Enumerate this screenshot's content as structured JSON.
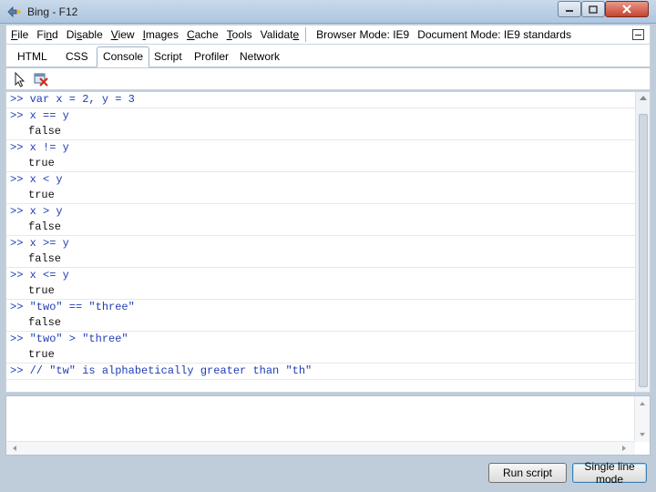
{
  "window": {
    "title": "Bing - F12"
  },
  "menu": {
    "items": [
      "File",
      "Find",
      "Disable",
      "View",
      "Images",
      "Cache",
      "Tools",
      "Validate"
    ],
    "accel": [
      "F",
      "n",
      "s",
      "V",
      "I",
      "C",
      "T",
      "e"
    ],
    "browser_mode": "Browser Mode: IE9",
    "document_mode": "Document Mode: IE9 standards"
  },
  "tabs": [
    "HTML",
    "CSS",
    "Console",
    "Script",
    "Profiler",
    "Network"
  ],
  "active_tab": "Console",
  "console": {
    "entries": [
      {
        "cmd": ">> var x = 2, y = 3",
        "res": ""
      },
      {
        "cmd": ">> x == y",
        "res": "false"
      },
      {
        "cmd": ">> x != y",
        "res": "true"
      },
      {
        "cmd": ">> x < y",
        "res": "true"
      },
      {
        "cmd": ">> x > y",
        "res": "false"
      },
      {
        "cmd": ">> x >= y",
        "res": "false"
      },
      {
        "cmd": ">> x <= y",
        "res": "true"
      },
      {
        "cmd": ">> \"two\" == \"three\"",
        "res": "false"
      },
      {
        "cmd": ">> \"two\" > \"three\"",
        "res": "true"
      },
      {
        "cmd": ">> // \"tw\" is alphabetically greater than \"th\"",
        "res": ""
      }
    ]
  },
  "input": {
    "value": ""
  },
  "buttons": {
    "run": "Run script",
    "single_line": "Single line mode"
  },
  "colors": {
    "command_text": "#1f3db5",
    "window_chrome": "#bfcddb"
  }
}
